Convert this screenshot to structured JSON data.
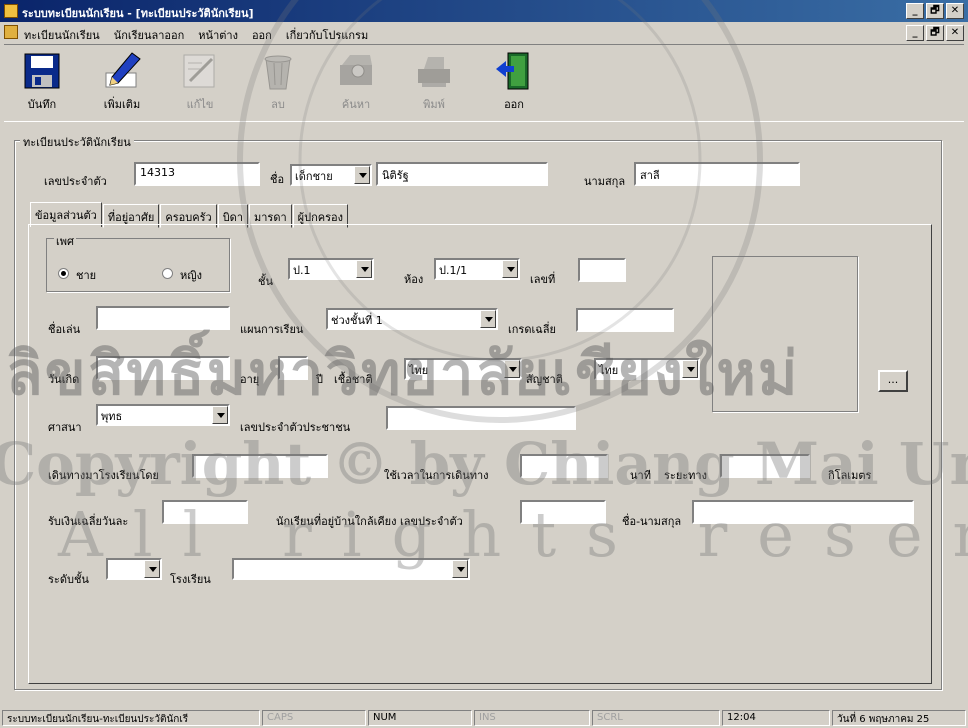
{
  "window": {
    "title": "ระบบทะเบียนนักเรียน - [ทะเบียนประวัตินักเรียน]",
    "buttons": [
      "_",
      "🗗",
      "✕"
    ]
  },
  "menubar": {
    "items": [
      "ทะเบียนนักเรียน",
      "นักเรียนลาออก",
      "หน้าต่าง",
      "ออก",
      "เกี่ยวกับโปรแกรม"
    ]
  },
  "toolbar": {
    "buttons": [
      {
        "label": "บันทึก",
        "icon": "floppy-save-icon",
        "enabled": true
      },
      {
        "label": "เพิ่มเติม",
        "icon": "pen-add-icon",
        "enabled": true
      },
      {
        "label": "แก้ไข",
        "icon": "edit-icon",
        "enabled": false
      },
      {
        "label": "ลบ",
        "icon": "trash-icon",
        "enabled": false
      },
      {
        "label": "ค้นหา",
        "icon": "search-icon",
        "enabled": false
      },
      {
        "label": "พิมพ์",
        "icon": "printer-icon",
        "enabled": false
      },
      {
        "label": "ออก",
        "icon": "exit-door-icon",
        "enabled": true
      }
    ]
  },
  "form": {
    "group_title": "ทะเบียนประวัตินักเรียน",
    "student_id_label": "เลขประจำตัว",
    "student_id": "14313",
    "name_label": "ชื่อ",
    "prefix": "เด็กชาย",
    "first_name": "นิติรัฐ",
    "surname_label": "นามสกุล",
    "surname": "สาลี"
  },
  "tabs": [
    "ข้อมูลส่วนตัว",
    "ที่อยู่อาศัย",
    "ครอบครัว",
    "บิดา",
    "มารดา",
    "ผู้ปกครอง"
  ],
  "personal": {
    "sex_group": "เพศ",
    "sex_male": "ชาย",
    "sex_female": "หญิง",
    "class_label": "ชั้น",
    "class_value": "ป.1",
    "room_label": "ห้อง",
    "room_value": "ป.1/1",
    "number_label": "เลขที่",
    "nickname_label": "ชื่อเล่น",
    "plan_label": "แผนการเรียน",
    "plan_value": "ช่วงชั้นที่ 1",
    "gpa_label": "เกรดเฉลี่ย",
    "birth_label": "วันเกิด",
    "age_label": "อายุ",
    "year_label": "ปี",
    "race_label": "เชื้อชาติ",
    "race_value": "ไทย",
    "nationality_label": "สัญชาติ",
    "nationality_value": "ไทย",
    "browse_label": "...",
    "religion_label": "ศาสนา",
    "religion_value": "พุทธ",
    "citizen_id_label": "เลขประจำตัวประชาชน",
    "travel_label": "เดินทางมาโรงเรียนโดย",
    "travel_time_label": "ใช้เวลาในการเดินทาง",
    "minute_label": "นาที",
    "distance_label": "ระยะทาง",
    "km_label": "กิโลเมตร",
    "allowance_label": "รับเงินเฉลี่ยวันละ",
    "neighbor_label": "นักเรียนที่อยู่บ้านใกล้เคียง เลขประจำตัว",
    "fullname_label": "ชื่อ-นามสกุล",
    "level_label": "ระดับชั้น",
    "school_label": "โรงเรียน"
  },
  "statusbar": {
    "message": "ระบบทะเบียนนักเรียน-ทะเบียนประวัตินักเรี",
    "caps": "CAPS",
    "num": "NUM",
    "ins": "INS",
    "scrl": "SCRL",
    "time": "12:04",
    "date": "วันที่ 6 พฤษภาคม 25"
  },
  "watermark": {
    "line1": "ลิขสิทธิ์มหาวิทยาลัยเชียงใหม่",
    "line2": "Copyright © by Chiang Mai University",
    "line3": "All rights reserved"
  }
}
